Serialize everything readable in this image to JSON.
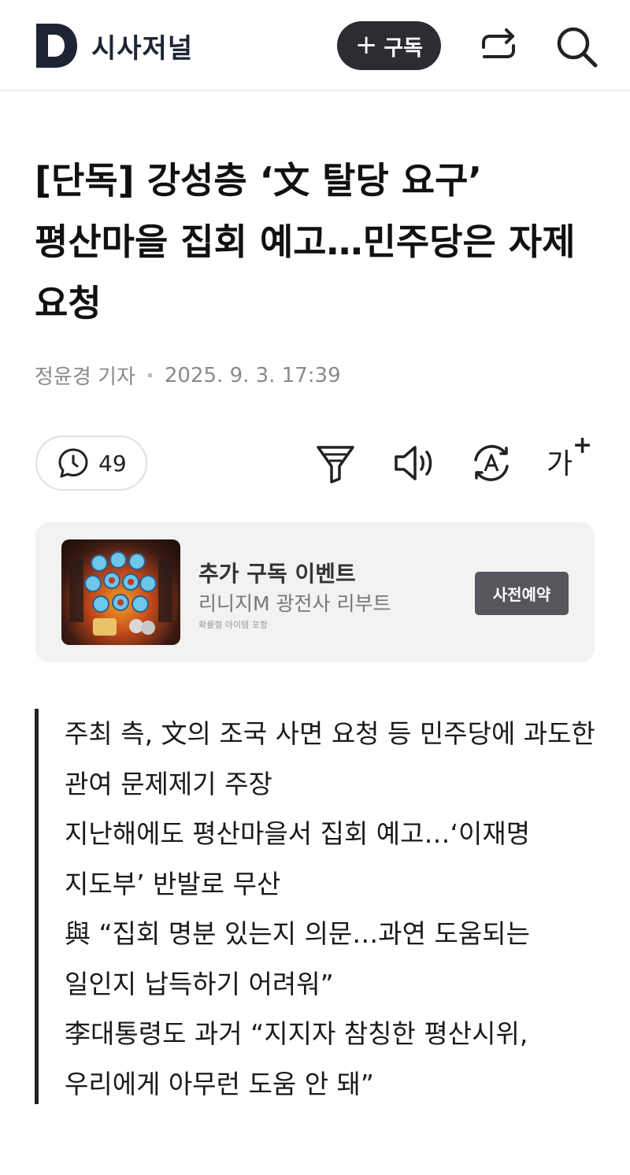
{
  "header": {
    "logo_letter": "D",
    "site_name": "시사저널",
    "subscribe_plus": "+",
    "subscribe_label": "구독",
    "share_icon": "share-icon",
    "search_icon": "search-icon"
  },
  "article": {
    "headline": "[단독] 강성층 ‘文 탈당 요구’ 평산마을 집회 예고…민주당은 자제 요청",
    "author": "정윤경 기자",
    "date": "2025. 9. 3. 17:39"
  },
  "toolbar": {
    "comment_count": "49",
    "font_size_label": "가",
    "font_size_plus": "+"
  },
  "ad": {
    "title": "추가 구독 이벤트",
    "subtitle": "리니지M 광전사 리부트",
    "note": "확률형 아이템 포함",
    "cta": "사전예약"
  },
  "summary": [
    "주최 측, 文의 조국 사면 요청 등 민주당에 과도한 관여 문제제기 주장",
    "지난해에도 평산마을서 집회 예고…‘이재명 지도부’ 반발로 무산",
    "與 “집회 명분 있는지 의문…과연 도움되는 일인지 납득하기 어려워”",
    "李대통령도 과거 “지지자 참칭한 평산시위, 우리에게 아무런 도움 안 돼”"
  ],
  "colors": {
    "subscribe_bg": "#2b2d33",
    "ad_bg": "#f2f2f2",
    "ad_cta_bg": "#55575c",
    "logo": "#1d2433"
  }
}
